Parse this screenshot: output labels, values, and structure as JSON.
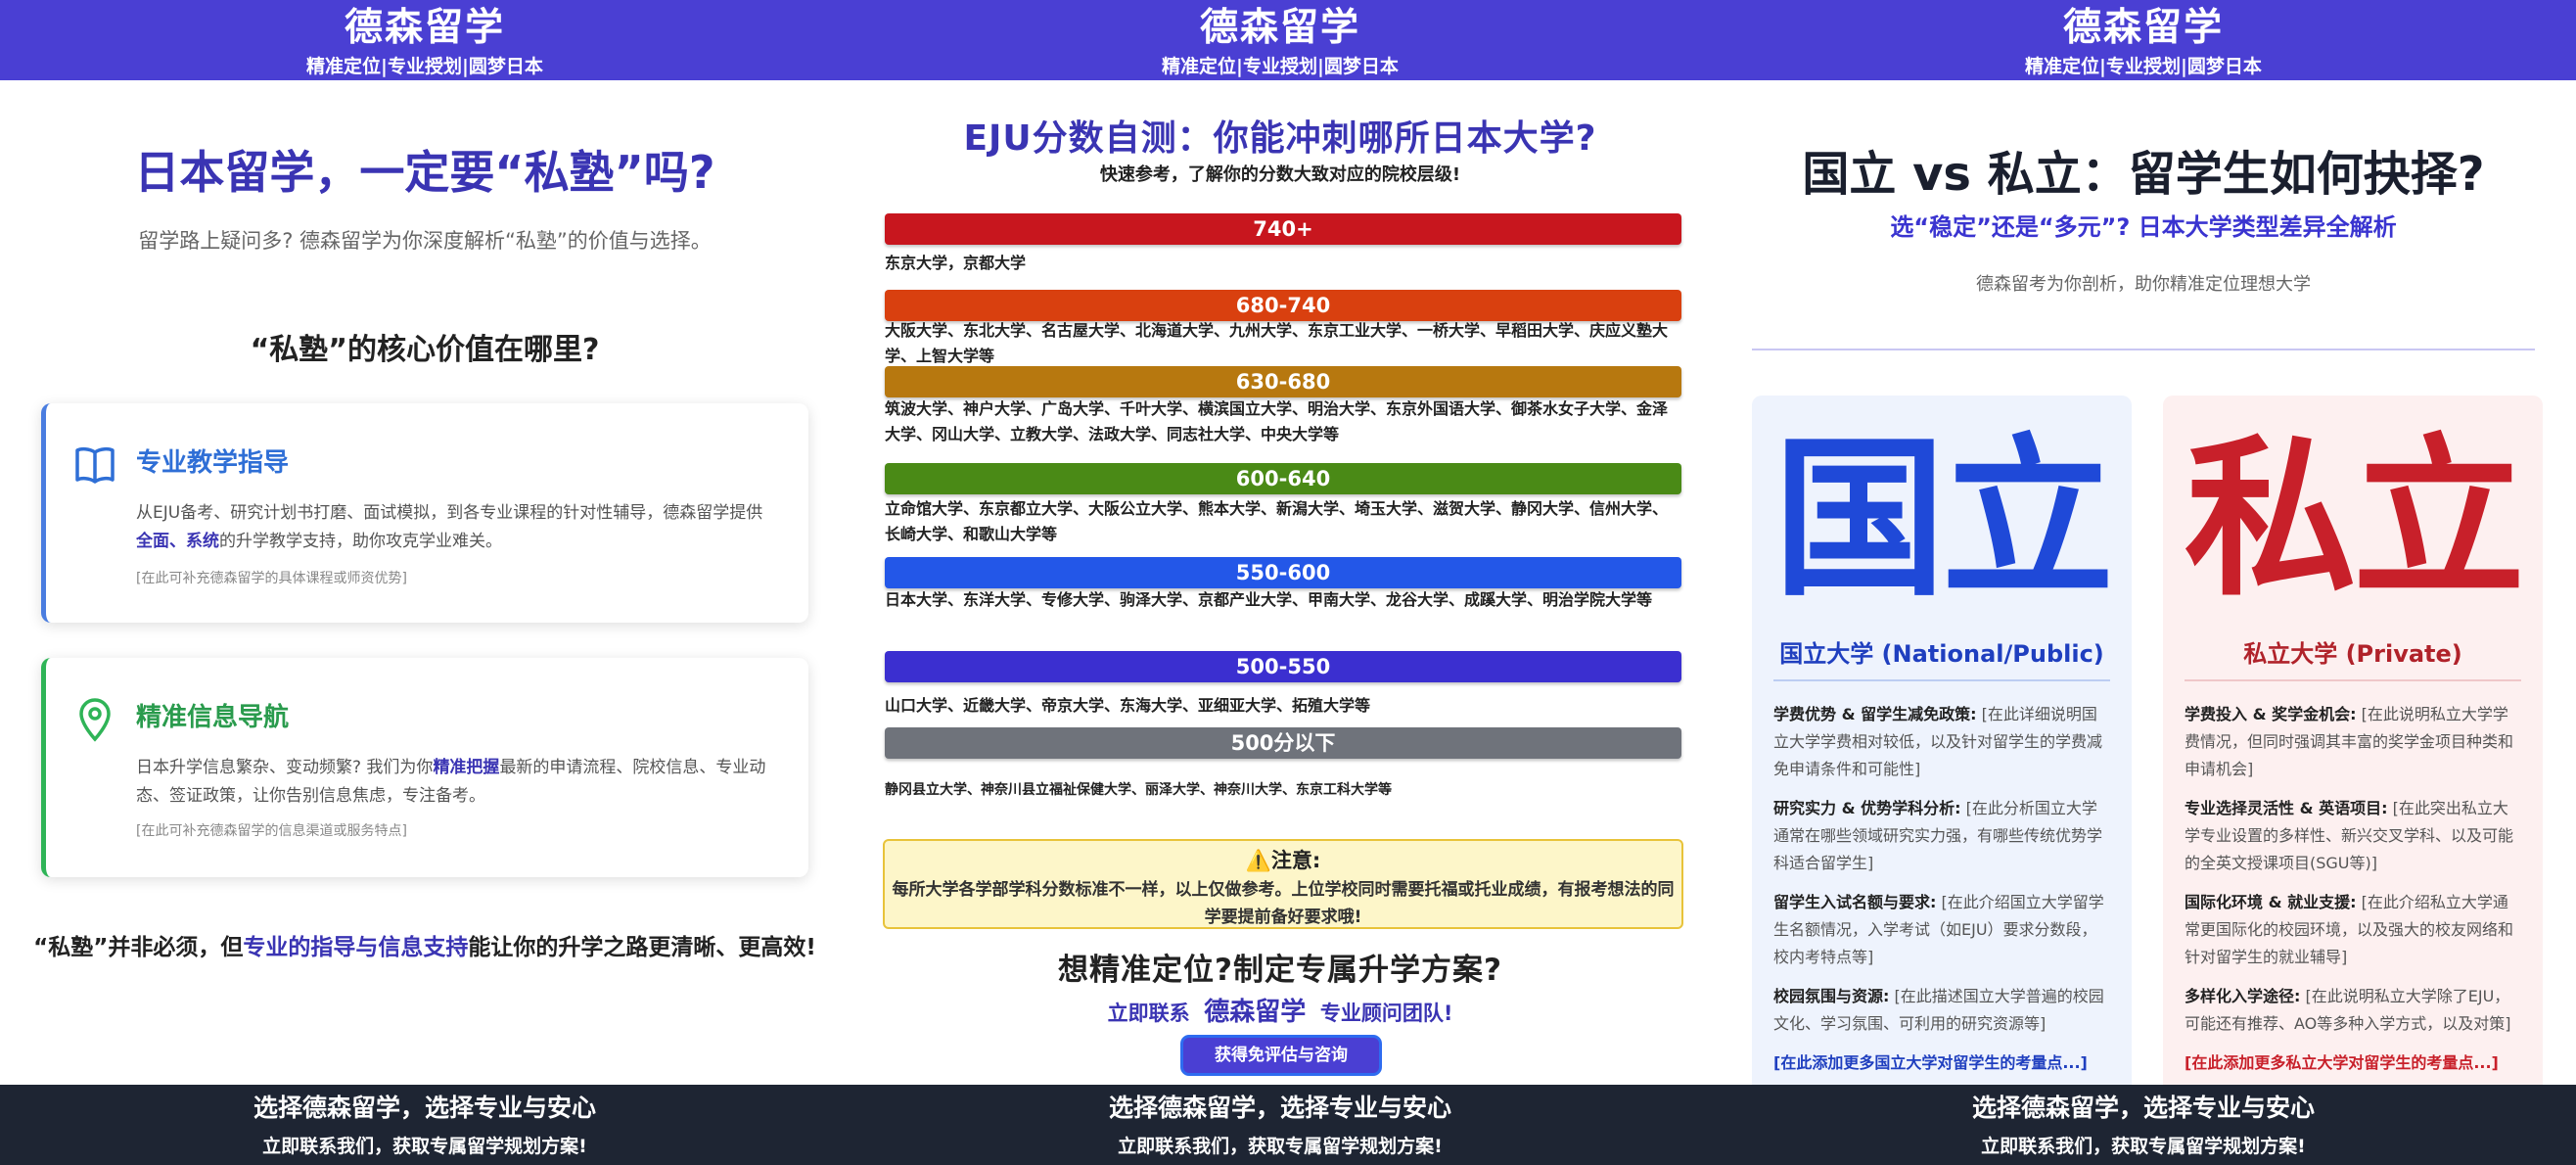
{
  "header": {
    "brand": "德森留学",
    "slogan": "精准定位|专业授划|圆梦日本"
  },
  "footer": {
    "line1": "选择德森留学，选择专业与安心",
    "line2": "立即联系我们，获取专属留学规划方案!"
  },
  "poster1": {
    "title": "日本留学，一定要“私塾”吗?",
    "subtitle": "留学路上疑问多? 德森留学为你深度解析“私塾”的价值与选择。",
    "section_heading": "“私塾”的核心价值在哪里?",
    "cards": [
      {
        "icon": "book-icon",
        "title": "专业教学指导",
        "title_color": "#2f6fd6",
        "body_pre": "从EJU备考、研究计划书打磨、面试模拟，到各专业课程的针对性辅导，德森留学提供",
        "body_hl": "全面、系统",
        "body_post": "的升学教学支持，助你攻克学业难关。",
        "note": "[在此可补充德森留学的具体课程或师资优势]"
      },
      {
        "icon": "location-pin-icon",
        "title": "精准信息导航",
        "title_color": "#2a9b4d",
        "body_pre": "日本升学信息繁杂、变动频繁? 我们为你",
        "body_hl": "精准把握",
        "body_post": "最新的申请流程、院校信息、专业动态、签证政策，让你告别信息焦虑，专注备考。",
        "note": "[在此可补充德森留学的信息渠道或服务特点]"
      }
    ],
    "bottom_pre": "“私塾”并非必须，但",
    "bottom_hl": "专业的指导与信息支持",
    "bottom_post": "能让你的升学之路更清晰、更高效!"
  },
  "poster2": {
    "title": "EJU分数自测：你能冲刺哪所日本大学?",
    "subtitle": "快速参考，了解你的分数大致对应的院校层级!",
    "tiers": [
      {
        "label": "740+",
        "color": "#c8161e",
        "unis": "东京大学，京都大学"
      },
      {
        "label": "680-740",
        "color": "#d9400f",
        "unis": "大阪大学、东北大学、名古屋大学、北海道大学、九州大学、东京工业大学、一桥大学、早稻田大学、庆应义塾大学、上智大学等"
      },
      {
        "label": "630-680",
        "color": "#b7780f",
        "unis": "筑波大学、神户大学、广岛大学、千叶大学、横滨国立大学、明治大学、东京外国语大学、御茶水女子大学、金泽大学、冈山大学、立教大学、法政大学、同志社大学、中央大学等"
      },
      {
        "label": "600-640",
        "color": "#4a8a16",
        "unis": "立命馆大学、东京都立大学、大阪公立大学、熊本大学、新潟大学、埼玉大学、滋贺大学、静冈大学、信州大学、长崎大学、和歌山大学等"
      },
      {
        "label": "550-600",
        "color": "#2357e8",
        "unis": "日本大学、东洋大学、专修大学、驹泽大学、京都产业大学、甲南大学、龙谷大学、成蹊大学、明治学院大学等"
      },
      {
        "label": "500-550",
        "color": "#3b2fd0",
        "unis": "山口大学、近畿大学、帝京大学、东海大学、亚细亚大学、拓殖大学等"
      },
      {
        "label": "500分以下",
        "color": "#6f737b",
        "unis": "静冈县立大学、神奈川县立福祉保健大学、丽泽大学、神奈川大学、东京工科大学等"
      }
    ],
    "note_title": "⚠️注意:",
    "note_body": "每所大学各学部学科分数标准不一样，以上仅做参考。上位学校同时需要托福或托业成绩，有报考想法的同学要提前备好要求哦!",
    "cta": "想精准定位?制定专属升学方案?",
    "contact_pre": "立即联系",
    "contact_brand": "德森留学",
    "contact_post": "专业顾问团队!",
    "button": "获得免评估与咨询"
  },
  "poster3": {
    "title": "国立 vs 私立：留学生如何抉择?",
    "subtitle": "选“稳定”还是“多元”? 日本大学类型差异全解析",
    "note": "德森留考为你剖析，助你精准定位理想大学",
    "national": {
      "big": "国立",
      "caption": "国立大学 (National/Public)",
      "items": [
        {
          "label": "学费优势 & 留学生减免政策:",
          "text": "[在此详细说明国立大学学费相对较低，以及针对留学生的学费减免申请条件和可能性]"
        },
        {
          "label": "研究实力 & 优势学科分析:",
          "text": "[在此分析国立大学通常在哪些领域研究实力强，有哪些传统优势学科适合留学生]"
        },
        {
          "label": "留学生入试名额与要求:",
          "text": "[在此介绍国立大学留学生名额情况，入学考试（如EJU）要求分数段，校内考特点等]"
        },
        {
          "label": "校园氛围与资源:",
          "text": "[在此描述国立大学普遍的校园文化、学习氛围、可利用的研究资源等]"
        }
      ],
      "more": "[在此添加更多国立大学对留学生的考量点...]"
    },
    "private": {
      "big": "私立",
      "caption": "私立大学 (Private)",
      "items": [
        {
          "label": "学费投入 & 奖学金机会:",
          "text": "[在此说明私立大学学费情况，但同时强调其丰富的奖学金项目种类和申请机会]"
        },
        {
          "label": "专业选择灵活性 & 英语项目:",
          "text": "[在此突出私立大学专业设置的多样性、新兴交叉学科、以及可能的全英文授课项目(SGU等)]"
        },
        {
          "label": "国际化环境 & 就业支援:",
          "text": "[在此介绍私立大学通常更国际化的校园环境，以及强大的校友网络和针对留学生的就业辅导]"
        },
        {
          "label": "多样化入学途径:",
          "text": "[在此说明私立大学除了EJU，可能还有推荐、AO等多种入学方式，以及对策]"
        }
      ],
      "more": "[在此添加更多私立大学对留学生的考量点...]"
    }
  }
}
